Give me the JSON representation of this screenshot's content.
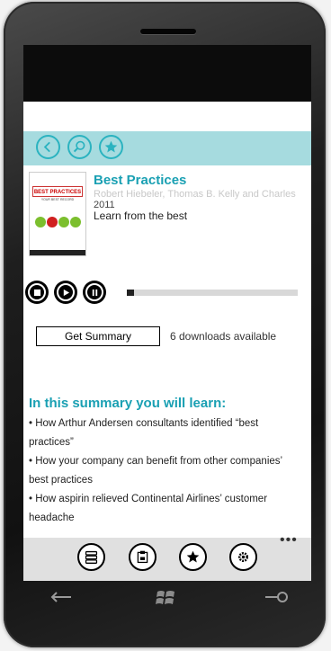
{
  "book": {
    "title": "Best Practices",
    "author": "Robert Hiebeler, Thomas B. Kelly and Charles",
    "year": "2011",
    "tagline": "Learn from the best",
    "cover": {
      "title": "BEST PRACTICES",
      "subtitle": "YOUR BEST RECORD"
    }
  },
  "player": {
    "progress": 0.04
  },
  "actions": {
    "summary_label": "Get Summary",
    "downloads_text": "6 downloads available"
  },
  "learn": {
    "heading": "In this summary you will learn:",
    "items": [
      "• How Arthur Andersen consultants identified “best",
      "practices”",
      "• How your company can benefit from other companies’",
      "best practices",
      "• How aspirin relieved Continental Airlines’ customer",
      "headache"
    ]
  },
  "appbar": {
    "more": "•••"
  },
  "colors": {
    "accent": "#1aa0b3",
    "toolbar": "#a6dbdf"
  },
  "icons": [
    "back-icon",
    "search-icon",
    "favorite-icon",
    "stop-icon",
    "play-icon",
    "pause-icon",
    "list-icon",
    "library-icon",
    "star-icon",
    "settings-icon",
    "windows-back-icon",
    "windows-start-icon",
    "windows-search-icon"
  ]
}
